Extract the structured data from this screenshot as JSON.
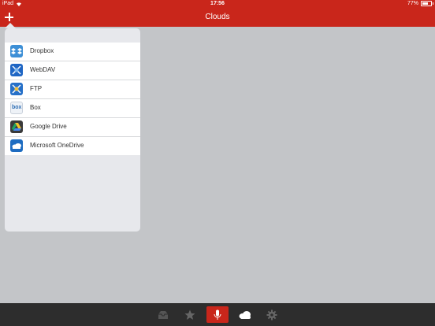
{
  "status": {
    "device": "iPad",
    "time": "17:56",
    "battery_text": "77%",
    "battery_level": 0.77
  },
  "nav": {
    "title": "Clouds"
  },
  "menu": {
    "items": [
      {
        "label": "Dropbox",
        "icon": "dropbox-icon"
      },
      {
        "label": "WebDAV",
        "icon": "webdav-icon"
      },
      {
        "label": "FTP",
        "icon": "ftp-icon"
      },
      {
        "label": "Box",
        "icon": "box-icon",
        "icon_text": "box"
      },
      {
        "label": "Google Drive",
        "icon": "google-drive-icon"
      },
      {
        "label": "Microsoft OneDrive",
        "icon": "onedrive-icon"
      }
    ]
  },
  "tabs": [
    {
      "icon": "inbox-icon"
    },
    {
      "icon": "star-icon"
    },
    {
      "icon": "microphone-icon",
      "active": true
    },
    {
      "icon": "cloud-icon"
    },
    {
      "icon": "gear-icon"
    }
  ],
  "colors": {
    "accent": "#c9261b",
    "tab_bar": "#2d2d2d",
    "background": "#c3c5c8"
  }
}
